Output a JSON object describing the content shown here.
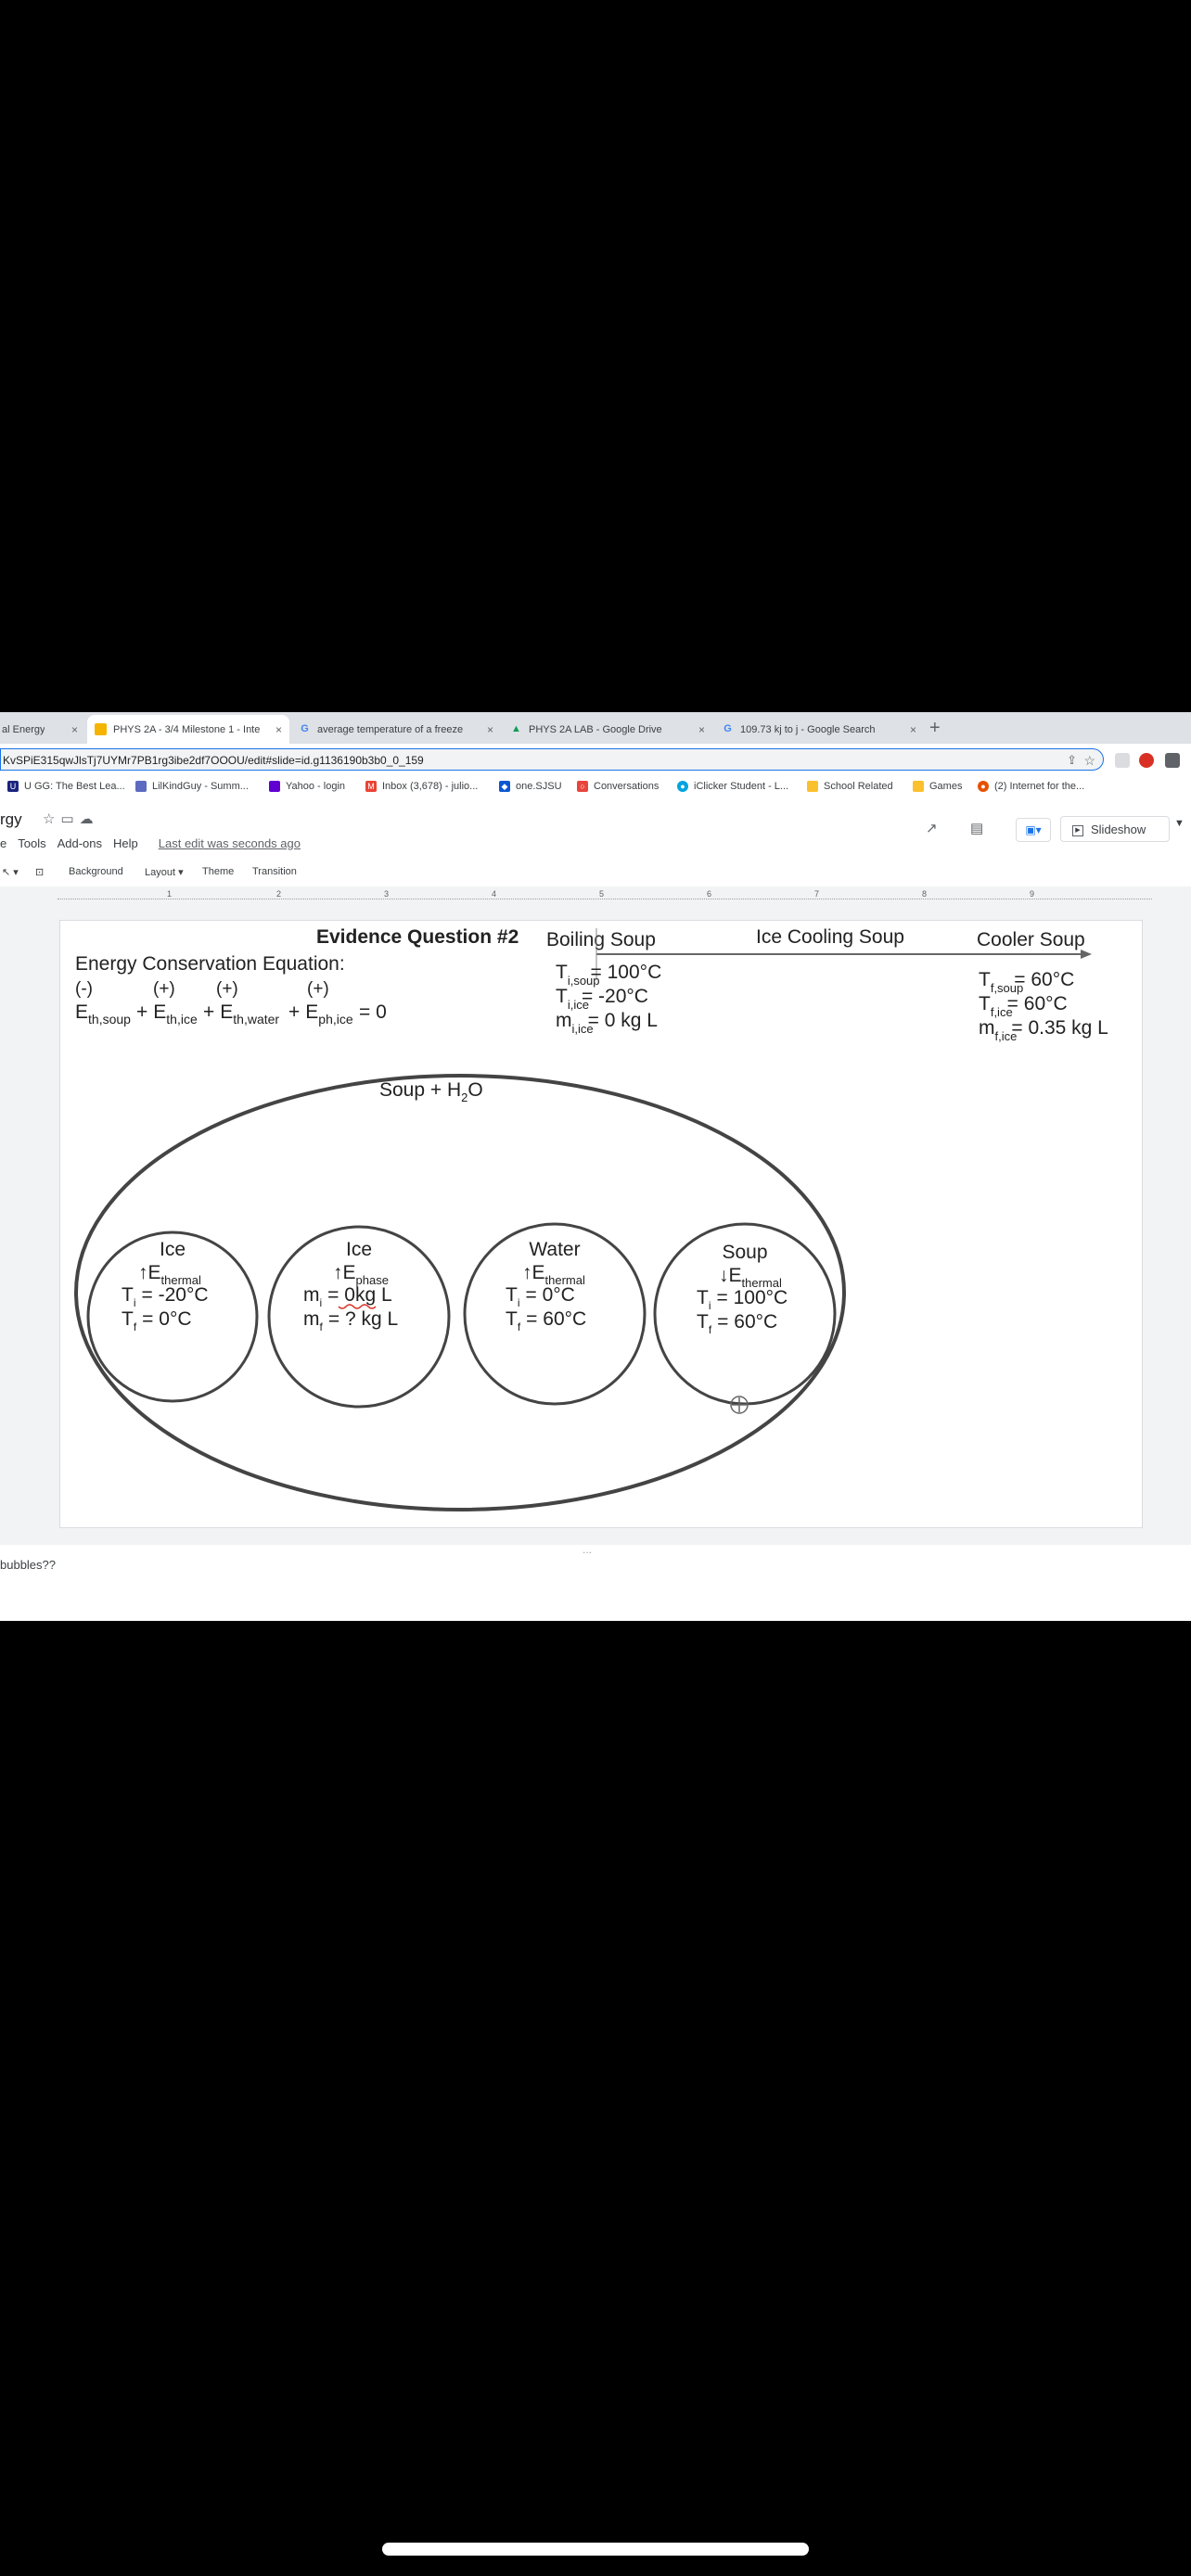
{
  "browser": {
    "tabs": [
      {
        "label": "al Energy",
        "icon": "sheets-icon"
      },
      {
        "label": "PHYS 2A - 3/4 Milestone 1 - Inte",
        "icon": "slides-icon"
      },
      {
        "label": "average temperature of a freeze",
        "icon": "google-icon"
      },
      {
        "label": "PHYS 2A LAB - Google Drive",
        "icon": "drive-icon"
      },
      {
        "label": "109.73 kj to j - Google Search",
        "icon": "google-icon"
      }
    ],
    "close": "×",
    "new_tab": "+",
    "url": "KvSPiE315qwJlsTj7UYMr7PB1rg3ibe2df7OOOU/edit#slide=id.g1136190b3b0_0_159",
    "bookmarks": [
      {
        "label": "U GG: The Best Lea...",
        "color": "#1a237e",
        "glyph": "U"
      },
      {
        "label": "LilKindGuy - Summ...",
        "color": "#5c6bc0",
        "glyph": ""
      },
      {
        "label": "Yahoo - login",
        "color": "#6001d2",
        "glyph": ""
      },
      {
        "label": "Inbox (3,678) - julio...",
        "color": "#ea4335",
        "glyph": "M"
      },
      {
        "label": "one.SJSU",
        "color": "#0b57d0",
        "glyph": "◆"
      },
      {
        "label": "Conversations",
        "color": "#e8453c",
        "glyph": "○"
      },
      {
        "label": "iClicker Student - L...",
        "color": "#00a3e0",
        "glyph": "●"
      },
      {
        "label": "School Related",
        "color": "#fbc02d",
        "glyph": ""
      },
      {
        "label": "Games",
        "color": "#fbc02d",
        "glyph": ""
      },
      {
        "label": "(2) Internet for the...",
        "color": "#e65100",
        "glyph": "●"
      }
    ]
  },
  "docs": {
    "title": "rgy",
    "menus": [
      "e",
      "Tools",
      "Add-ons",
      "Help"
    ],
    "last_edit": "Last edit was seconds ago",
    "slideshow_label": "Slideshow",
    "toolbar": [
      "Background",
      "Layout ▾",
      "Theme",
      "Transition"
    ],
    "ruler": [
      "1",
      "2",
      "3",
      "4",
      "5",
      "6",
      "7",
      "8",
      "9"
    ]
  },
  "slide": {
    "title": "Evidence Question #2",
    "equation_heading": "Energy Conservation Equation:",
    "signs": [
      "(-)",
      "(+)",
      "(+)",
      "(+)"
    ],
    "equation_terms": [
      {
        "main": "E",
        "sub": "th,soup",
        "plus": ""
      },
      {
        "main": "E",
        "sub": "th,ice",
        "plus": "+"
      },
      {
        "main": "E",
        "sub": "th,water",
        "plus": "+"
      },
      {
        "main": "E",
        "sub": "ph,ice",
        "plus": "+"
      }
    ],
    "equation_end": "= 0",
    "timeline": {
      "boiling": "Boiling Soup",
      "ice_cooling": "Ice Cooling Soup",
      "cooler": "Cooler Soup"
    },
    "initial": [
      {
        "main": "T",
        "sub": "i,soup",
        "value": "= 100°C"
      },
      {
        "main": "T",
        "sub": "i,ice",
        "value": "= -20°C"
      },
      {
        "main": "m",
        "sub": "i,ice",
        "value": "= 0 kg L"
      }
    ],
    "final": [
      {
        "main": "T",
        "sub": "f,soup",
        "value": "= 60°C"
      },
      {
        "main": "T",
        "sub": "f,ice",
        "value": "= 60°C"
      },
      {
        "main": "m",
        "sub": "f,ice",
        "value": "= 0.35 kg L"
      }
    ],
    "system_label": "Soup + H",
    "system_sub": "2",
    "system_end": "O",
    "circles": [
      {
        "name": "Ice",
        "arrow": "↑E",
        "energy_sub": "thermal",
        "line1": {
          "main": "T",
          "sub": "i",
          "value": "= -20°C"
        },
        "line2": {
          "main": "T",
          "sub": "f",
          "value": "= 0°C"
        }
      },
      {
        "name": "Ice",
        "arrow": "↑E",
        "energy_sub": "phase",
        "line1": {
          "main": "m",
          "sub": "i",
          "value": "= 0kg L"
        },
        "line2": {
          "main": "m",
          "sub": "f",
          "value": "= ? kg L"
        }
      },
      {
        "name": "Water",
        "arrow": "↑E",
        "energy_sub": "thermal",
        "line1": {
          "main": "T",
          "sub": "i",
          "value": "= 0°C"
        },
        "line2": {
          "main": "T",
          "sub": "f",
          "value": "= 60°C"
        }
      },
      {
        "name": "Soup",
        "arrow": "↓E",
        "energy_sub": "thermal",
        "line1": {
          "main": "T",
          "sub": "i",
          "value": "= 100°C"
        },
        "line2": {
          "main": "T",
          "sub": "f",
          "value": "= 60°C"
        }
      }
    ]
  },
  "notes": {
    "text": "bubbles??",
    "handle": "..."
  }
}
